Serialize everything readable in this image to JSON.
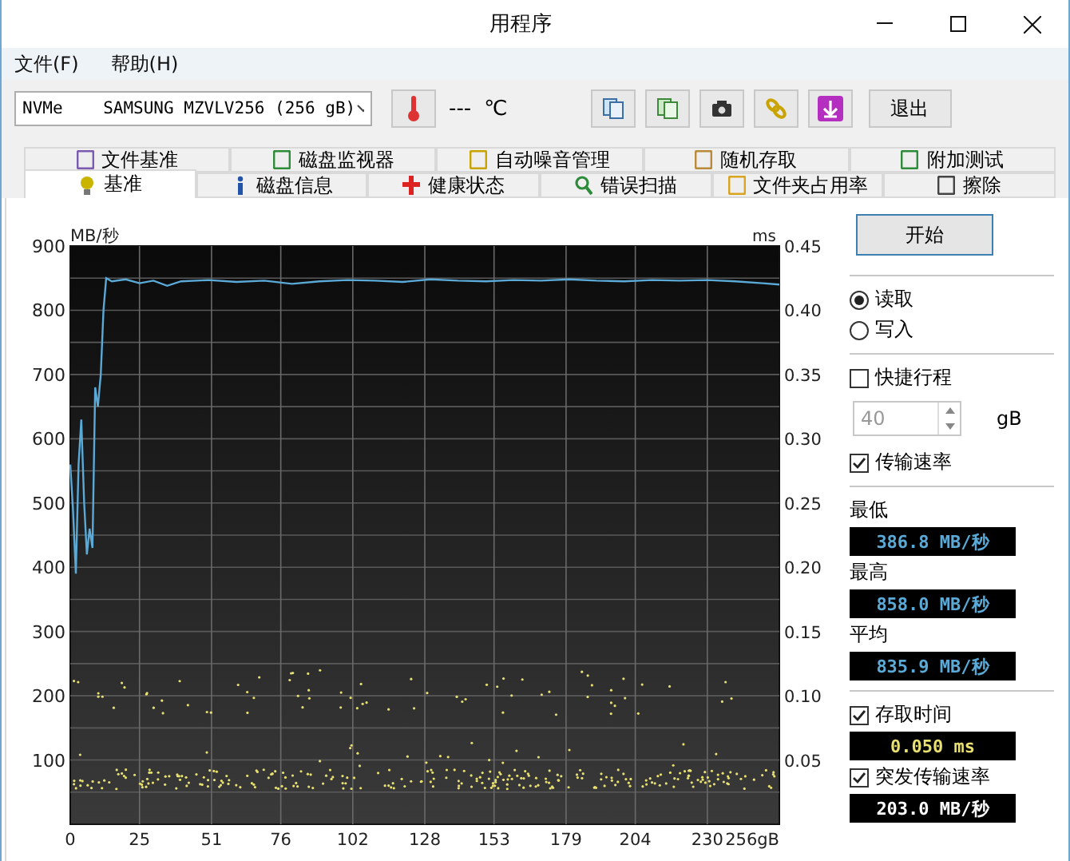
{
  "window": {
    "title": "用程序"
  },
  "menu": [
    "文件(F)",
    "帮助(H)"
  ],
  "toolbar": {
    "drive": "NVMe    SAMSUNG MZVLV256 (256 gB)",
    "temperature": "---",
    "temperature_unit": "℃",
    "exit_button": "退出"
  },
  "tab_rows": [
    [
      {
        "label": "文件基准",
        "selected": false
      },
      {
        "label": "磁盘监视器",
        "selected": false
      },
      {
        "label": "自动噪音管理",
        "selected": false
      },
      {
        "label": "随机存取",
        "selected": false
      },
      {
        "label": "附加测试",
        "selected": false
      }
    ],
    [
      {
        "label": "基准",
        "selected": true
      },
      {
        "label": "磁盘信息",
        "selected": false
      },
      {
        "label": "健康状态",
        "selected": false
      },
      {
        "label": "错误扫描",
        "selected": false
      },
      {
        "label": "文件夹占用率",
        "selected": false
      },
      {
        "label": "擦除",
        "selected": false
      }
    ]
  ],
  "benchmark": {
    "chart_data": {
      "type": "line",
      "grid": true,
      "ylabel": "MB/秒",
      "xlim": [
        0,
        256
      ],
      "ylim": [
        0,
        900
      ],
      "xticks": [
        0,
        25,
        51,
        76,
        102,
        128,
        153,
        179,
        204,
        230,
        {
          "value": 256,
          "label": "256gB"
        }
      ],
      "yticks": [
        100,
        200,
        300,
        400,
        500,
        600,
        700,
        800,
        900
      ],
      "x": [
        0,
        1,
        2,
        3,
        4,
        5,
        6,
        7,
        8,
        9,
        10,
        11,
        12,
        13,
        15,
        20,
        25,
        30,
        35,
        40,
        50,
        60,
        70,
        80,
        90,
        100,
        110,
        120,
        130,
        140,
        150,
        160,
        170,
        180,
        190,
        200,
        210,
        220,
        230,
        240,
        250,
        256
      ],
      "series": [
        {
          "color": "#5aa9d6",
          "values": [
            560,
            490,
            390,
            560,
            630,
            500,
            420,
            460,
            430,
            680,
            650,
            700,
            800,
            850,
            845,
            848,
            842,
            846,
            838,
            845,
            847,
            844,
            846,
            841,
            845,
            847,
            846,
            844,
            848,
            846,
            845,
            847,
            846,
            848,
            846,
            845,
            847,
            846,
            847,
            845,
            842,
            840
          ]
        }
      ]
    },
    "access_axis": {
      "unit": "ms",
      "ticks": [
        "0.45",
        "0.40",
        "0.35",
        "0.30",
        "0.25",
        "0.20",
        "0.15",
        "0.10",
        "0.05"
      ]
    },
    "start_button": "开始",
    "modes": [
      {
        "label": "读取",
        "selected": true
      },
      {
        "label": "写入",
        "selected": false
      }
    ],
    "short_stroke": {
      "label": "快捷行程",
      "checked": false,
      "value": "40",
      "disabled": true,
      "unit": "gB"
    },
    "transfer_rate": {
      "label": "传输速率",
      "checked": true
    },
    "readouts": [
      {
        "label": "最低",
        "value": "386.8 MB/秒"
      },
      {
        "label": "最高",
        "value": "858.0 MB/秒"
      },
      {
        "label": "平均",
        "value": "835.9 MB/秒"
      }
    ],
    "access_time": {
      "label": "存取时间",
      "checked": true,
      "value": "0.050 ms"
    },
    "burst_rate": {
      "label": "突发传输速率",
      "checked": true,
      "value": "203.0 MB/秒"
    }
  }
}
